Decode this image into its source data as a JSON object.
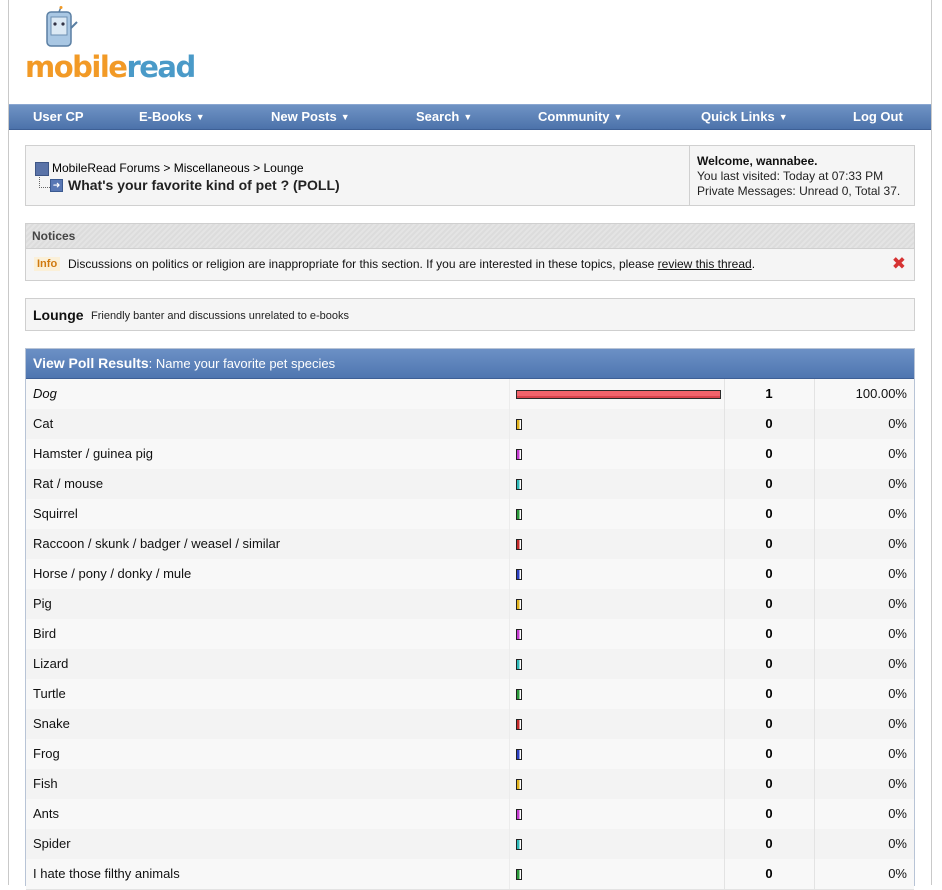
{
  "logo": {
    "part1": "mobile",
    "part2": "read"
  },
  "nav": [
    {
      "label": "User CP",
      "dropdown": false
    },
    {
      "label": "E-Books",
      "dropdown": true
    },
    {
      "label": "New Posts",
      "dropdown": true
    },
    {
      "label": "Search",
      "dropdown": true
    },
    {
      "label": "Community",
      "dropdown": true
    },
    {
      "label": "Quick Links",
      "dropdown": true
    },
    {
      "label": "Log Out",
      "dropdown": false
    }
  ],
  "breadcrumb": {
    "root": "MobileRead Forums",
    "sep": ">",
    "section": "Miscellaneous",
    "forum": "Lounge",
    "thread_title": "What's your favorite kind of pet ? (POLL)"
  },
  "welcome": {
    "greeting": "Welcome, wannabee.",
    "last_visited": "You last visited: Today at 07:33 PM",
    "pm_prefix": "Private Messages:",
    "pm_counts": "Unread 0, Total 37."
  },
  "notices": {
    "title": "Notices",
    "badge": "Info",
    "text": "Discussions on politics or religion are inappropriate for this section. If you are interested in these topics, please",
    "link": "review this thread",
    "suffix": "."
  },
  "forum": {
    "title": "Lounge",
    "description": "Friendly banter and discussions unrelated to e-books"
  },
  "poll": {
    "heading": "View Poll Results",
    "question": ": Name your favorite pet species",
    "bar_colors": [
      "#2a3fc2",
      "#e0b21c",
      "#c43ad0",
      "#2bb8b8",
      "#2a9a3a",
      "#c42a2a"
    ],
    "options": [
      {
        "label": "Dog",
        "votes": "1",
        "percent": "100.00%",
        "fraction": 1.0,
        "winner": true
      },
      {
        "label": "Cat",
        "votes": "0",
        "percent": "0%",
        "fraction": 0
      },
      {
        "label": "Hamster / guinea pig",
        "votes": "0",
        "percent": "0%",
        "fraction": 0
      },
      {
        "label": "Rat / mouse",
        "votes": "0",
        "percent": "0%",
        "fraction": 0
      },
      {
        "label": "Squirrel",
        "votes": "0",
        "percent": "0%",
        "fraction": 0
      },
      {
        "label": "Raccoon / skunk / badger / weasel / similar",
        "votes": "0",
        "percent": "0%",
        "fraction": 0
      },
      {
        "label": "Horse / pony / donky / mule",
        "votes": "0",
        "percent": "0%",
        "fraction": 0
      },
      {
        "label": "Pig",
        "votes": "0",
        "percent": "0%",
        "fraction": 0
      },
      {
        "label": "Bird",
        "votes": "0",
        "percent": "0%",
        "fraction": 0
      },
      {
        "label": "Lizard",
        "votes": "0",
        "percent": "0%",
        "fraction": 0
      },
      {
        "label": "Turtle",
        "votes": "0",
        "percent": "0%",
        "fraction": 0
      },
      {
        "label": "Snake",
        "votes": "0",
        "percent": "0%",
        "fraction": 0
      },
      {
        "label": "Frog",
        "votes": "0",
        "percent": "0%",
        "fraction": 0
      },
      {
        "label": "Fish",
        "votes": "0",
        "percent": "0%",
        "fraction": 0
      },
      {
        "label": "Ants",
        "votes": "0",
        "percent": "0%",
        "fraction": 0
      },
      {
        "label": "Spider",
        "votes": "0",
        "percent": "0%",
        "fraction": 0
      },
      {
        "label": "I hate those filthy animals",
        "votes": "0",
        "percent": "0%",
        "fraction": 0
      }
    ]
  }
}
